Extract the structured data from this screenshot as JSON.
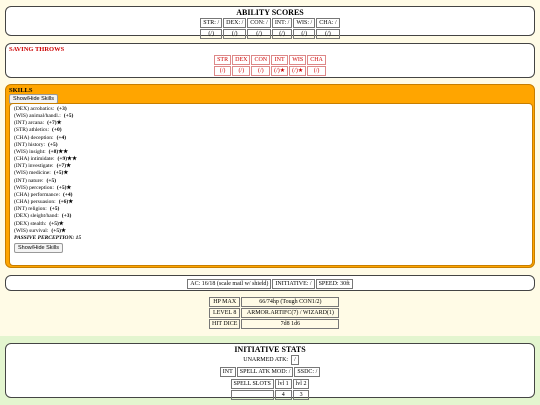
{
  "ability_scores": {
    "title": "ABILITY SCORES",
    "labels": [
      "STR: /",
      "DEX: /",
      "CON: /",
      "INT: /",
      "WIS: /",
      "CHA: /"
    ],
    "mods": [
      "(/)",
      "(/)",
      "(/)",
      "(/)",
      "(/)",
      "(/)"
    ]
  },
  "saving_throws": {
    "title": "SAVING THROWS",
    "labels": [
      "STR",
      "DEX",
      "CON",
      "INT",
      "WIS",
      "CHA"
    ],
    "values": [
      "(/)",
      "(/)",
      "(/)",
      "(/)★",
      "(/)★",
      "(/)"
    ]
  },
  "skills": {
    "title": "SKILLS",
    "toggle_label": "Show/Hide Skills",
    "items": [
      {
        "name": "(DEX) acrobatics:",
        "bonus": "(+3)",
        "stars": ""
      },
      {
        "name": "(WIS) animal/handl.:",
        "bonus": "(+5)",
        "stars": ""
      },
      {
        "name": "(INT) arcana:",
        "bonus": "(+7)",
        "stars": "★"
      },
      {
        "name": "(STR) athletics:",
        "bonus": "(+0)",
        "stars": ""
      },
      {
        "name": "(CHA) deception:",
        "bonus": "(+4)",
        "stars": ""
      },
      {
        "name": "(INT) history:",
        "bonus": "(+5)",
        "stars": ""
      },
      {
        "name": "(WIS) insight:",
        "bonus": "(+8)",
        "stars": "★★"
      },
      {
        "name": "(CHA) intimidate:",
        "bonus": "(+9)",
        "stars": "★★"
      },
      {
        "name": "(INT) investigate:",
        "bonus": "(+7)",
        "stars": "★"
      },
      {
        "name": "(WIS) medicine:",
        "bonus": "(+5)",
        "stars": "★"
      },
      {
        "name": "(INT) nature:",
        "bonus": "(+5)",
        "stars": ""
      },
      {
        "name": "(WIS) perception:",
        "bonus": "(+5)",
        "stars": "★"
      },
      {
        "name": "(CHA) performance:",
        "bonus": "(+4)",
        "stars": ""
      },
      {
        "name": "(CHA) persuasion:",
        "bonus": "(+6)",
        "stars": "★"
      },
      {
        "name": "(INT) religion:",
        "bonus": "(+5)",
        "stars": ""
      },
      {
        "name": "(DEX) sleight/hand:",
        "bonus": "(+3)",
        "stars": ""
      },
      {
        "name": "(DEX) stealth:",
        "bonus": "(+5)",
        "stars": "★"
      },
      {
        "name": "(WIS) survival:",
        "bonus": "(+5)",
        "stars": "★"
      }
    ],
    "passive_perception": "PASSIVE PERCEPTION: 15"
  },
  "combat": {
    "ac": "AC: 16/18 (scale mail w/ shield)",
    "initiative": "INITIATIVE: /",
    "speed": "SPEED: 30ft"
  },
  "vitals": {
    "hp_label": "HP MAX",
    "hp_value": "66/74hp (Tough CON1/2)",
    "level_label": "LEVEL 8",
    "level_value": "ARMOR.ARTIFC(7) / WIZARD(1)",
    "hitdice_label": "HIT DICE",
    "hitdice_value": "7d8 1d6"
  },
  "initiative_stats": {
    "title": "INITIATIVE STATS",
    "unarmed_label": "UNARMED ATK:",
    "unarmed_value": "/",
    "int_label": "INT",
    "spell_atk": "SPELL ATK MOD: /",
    "spell_dc": "SSDC: /",
    "slots_label": "SPELL SLOTS",
    "slot_levels": [
      "lvl 1",
      "lvl 2"
    ],
    "slot_counts": [
      "4",
      "3"
    ]
  },
  "colors": {
    "skills_bg": "#ffa500",
    "saving_red": "#cc0000",
    "initiative_bg": "#e3f5cf"
  }
}
